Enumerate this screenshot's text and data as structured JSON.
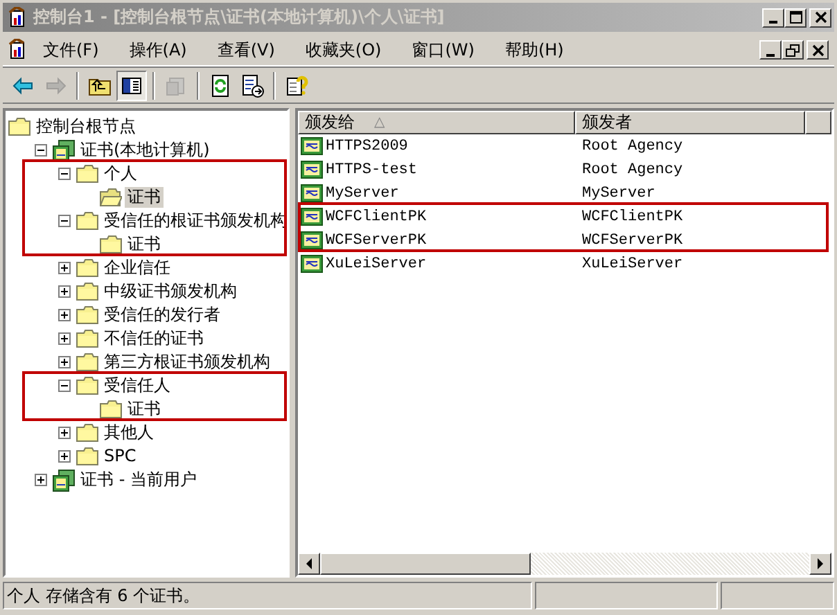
{
  "window": {
    "title": "控制台1 - [控制台根节点\\证书(本地计算机)\\个人\\证书]",
    "active": false
  },
  "menu": [
    "文件(F)",
    "操作(A)",
    "查看(V)",
    "收藏夹(O)",
    "窗口(W)",
    "帮助(H)"
  ],
  "toolbar": [
    {
      "kind": "back",
      "disabled": false,
      "pressed": false
    },
    {
      "kind": "forward",
      "disabled": true,
      "pressed": false
    },
    {
      "kind": "sep"
    },
    {
      "kind": "up",
      "disabled": false,
      "pressed": false
    },
    {
      "kind": "tree",
      "disabled": false,
      "pressed": true
    },
    {
      "kind": "sep"
    },
    {
      "kind": "props",
      "disabled": true,
      "pressed": false
    },
    {
      "kind": "sep"
    },
    {
      "kind": "refresh",
      "disabled": false,
      "pressed": false
    },
    {
      "kind": "export",
      "disabled": false,
      "pressed": false
    },
    {
      "kind": "sep"
    },
    {
      "kind": "help",
      "disabled": false,
      "pressed": false
    }
  ],
  "tree": [
    {
      "label": "控制台根节点",
      "kind": "root",
      "selected": false,
      "highlighted": false,
      "children": [
        {
          "label": "证书(本地计算机)",
          "kind": "store",
          "expanded": true,
          "selected": false,
          "highlighted": false,
          "children": [
            {
              "label": "个人",
              "kind": "folder",
              "expanded": true,
              "selected": false,
              "highlighted": true,
              "children": [
                {
                  "label": "证书",
                  "kind": "folder",
                  "selected": true,
                  "highlighted": true
                }
              ]
            },
            {
              "label": "受信任的根证书颁发机构",
              "kind": "folder",
              "expanded": true,
              "selected": false,
              "highlighted": true,
              "children": [
                {
                  "label": "证书",
                  "kind": "folder",
                  "selected": false,
                  "highlighted": true
                }
              ]
            },
            {
              "label": "企业信任",
              "kind": "folder",
              "expanded": false,
              "selected": false,
              "highlighted": false
            },
            {
              "label": "中级证书颁发机构",
              "kind": "folder",
              "expanded": false,
              "selected": false,
              "highlighted": false
            },
            {
              "label": "受信任的发行者",
              "kind": "folder",
              "expanded": false,
              "selected": false,
              "highlighted": false
            },
            {
              "label": "不信任的证书",
              "kind": "folder",
              "expanded": false,
              "selected": false,
              "highlighted": false
            },
            {
              "label": "第三方根证书颁发机构",
              "kind": "folder",
              "expanded": false,
              "selected": false,
              "highlighted": false
            },
            {
              "label": "受信任人",
              "kind": "folder",
              "expanded": true,
              "selected": false,
              "highlighted": true,
              "children": [
                {
                  "label": "证书",
                  "kind": "folder",
                  "selected": false,
                  "highlighted": true
                }
              ]
            },
            {
              "label": "其他人",
              "kind": "folder",
              "expanded": false,
              "selected": false,
              "highlighted": false
            },
            {
              "label": "SPC",
              "kind": "folder",
              "expanded": false,
              "selected": false,
              "highlighted": false
            }
          ]
        },
        {
          "label": "证书 - 当前用户",
          "kind": "store",
          "expanded": false,
          "selected": false,
          "highlighted": false
        }
      ]
    }
  ],
  "list": {
    "columns": [
      {
        "label": "颁发给",
        "sort_mark": "△"
      },
      {
        "label": "颁发者"
      }
    ],
    "rows": [
      {
        "cells": [
          "HTTPS2009",
          "Root Agency"
        ],
        "highlighted": false
      },
      {
        "cells": [
          "HTTPS-test",
          "Root Agency"
        ],
        "highlighted": false
      },
      {
        "cells": [
          "MyServer",
          "MyServer"
        ],
        "highlighted": false
      },
      {
        "cells": [
          "WCFClientPK",
          "WCFClientPK"
        ],
        "highlighted": true
      },
      {
        "cells": [
          "WCFServerPK",
          "WCFServerPK"
        ],
        "highlighted": true
      },
      {
        "cells": [
          "XuLeiServer",
          "XuLeiServer"
        ],
        "highlighted": false
      }
    ]
  },
  "status_bar": "个人 存储含有 6 个证书。"
}
